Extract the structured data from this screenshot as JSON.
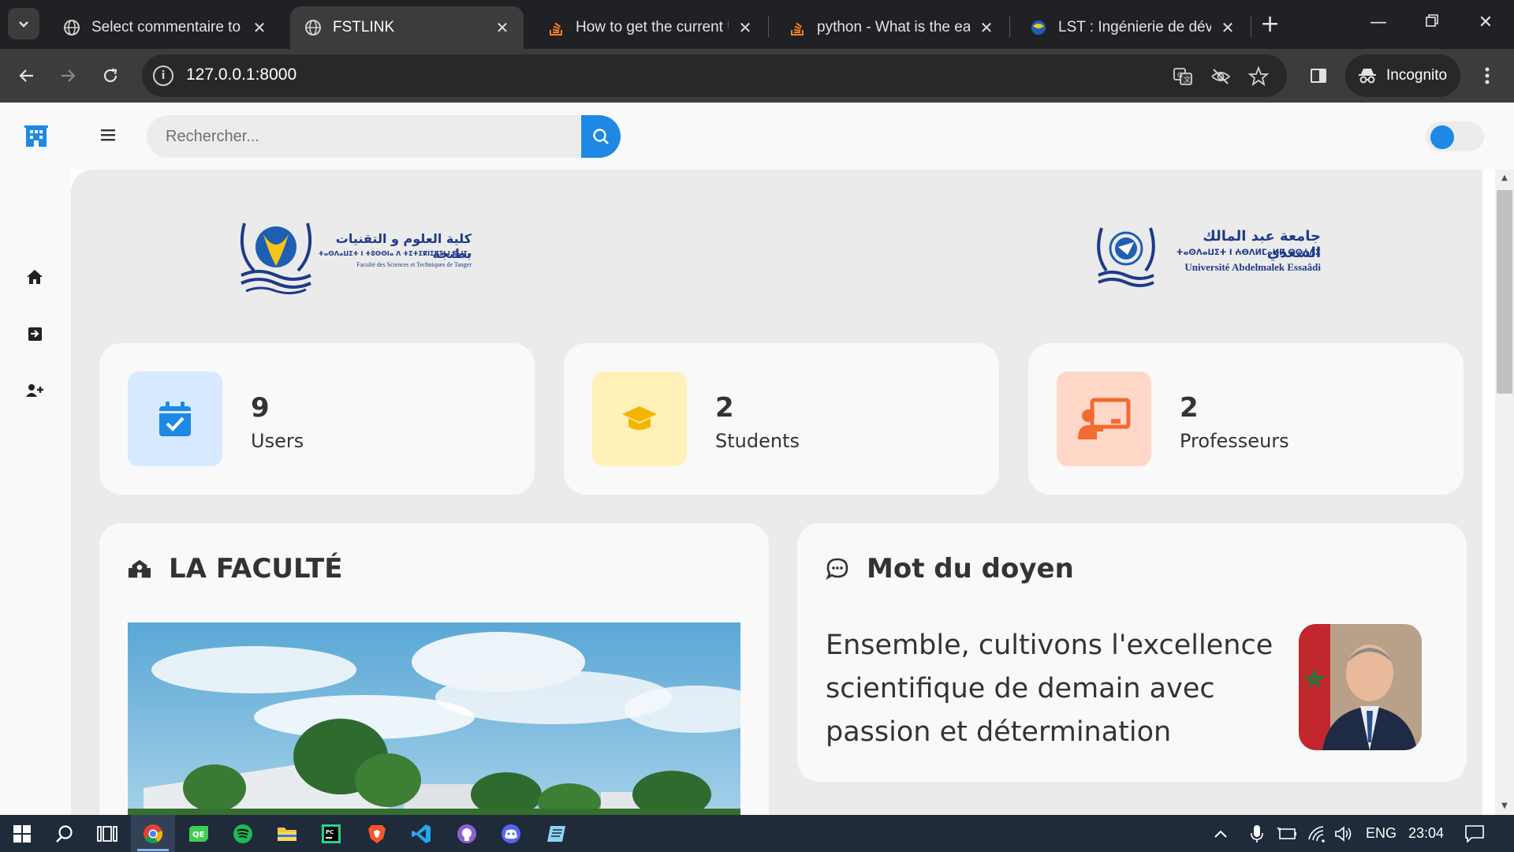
{
  "browser": {
    "tabs": [
      {
        "title": "Select commentaire to ch",
        "favicon": "globe-icon",
        "active": false
      },
      {
        "title": "FSTLINK",
        "favicon": "globe-icon",
        "active": true
      },
      {
        "title": "How to get the current U",
        "favicon": "stackoverflow-icon",
        "active": false
      },
      {
        "title": "python - What is the easi",
        "favicon": "stackoverflow-icon",
        "active": false
      },
      {
        "title": "LST : Ingénierie de dévelo",
        "favicon": "university-icon",
        "active": false
      }
    ],
    "url": "127.0.0.1:8000",
    "incognito_label": "Incognito"
  },
  "app": {
    "search": {
      "placeholder": "Rechercher..."
    },
    "logos": {
      "left": {
        "arabic": "كلية العلوم و التقنيات بطنجة",
        "tifinagh": "ⵜⴰⵙⴷⴰⵡⵉⵜ ⵏ ⵜⵓⵙⵙⵏⴰ ⴷ ⵜⵉⵜⵉⴽⵏⵉⴽⵉⵏ ⵏ ⵟⴰⵏⵊⴰ",
        "french": "Faculté des Sciences et Techniques de Tanger"
      },
      "right": {
        "arabic": "جامعة عبد المالك السعدي",
        "tifinagh": "ⵜⴰⵙⴷⴰⵡⵉⵜ ⵏ ⵄⴱⴷⵍⵎⴰⵍⴽ ⵙⵙⵄⴷⵉ",
        "french": "Université Abdelmalek Essaâdi"
      }
    },
    "stats": [
      {
        "value": "9",
        "label": "Users",
        "icon": "calendar-check-icon",
        "bg": "#d6e9ff",
        "color": "#1e88e5"
      },
      {
        "value": "2",
        "label": "Students",
        "icon": "graduation-cap-icon",
        "bg": "#fff1b8",
        "color": "#f5b400"
      },
      {
        "value": "2",
        "label": "Professeurs",
        "icon": "teacher-board-icon",
        "bg": "#ffd7c7",
        "color": "#f26b30"
      }
    ],
    "faculte": {
      "title": "LA FACULTÉ",
      "icon": "school-icon"
    },
    "doyen": {
      "title": "Mot du doyen",
      "icon": "comment-dots-icon",
      "quote": "Ensemble, cultivons l'excellence scientifique de demain avec passion et détermination"
    }
  },
  "taskbar": {
    "language": "ENG",
    "time": "23:04"
  }
}
